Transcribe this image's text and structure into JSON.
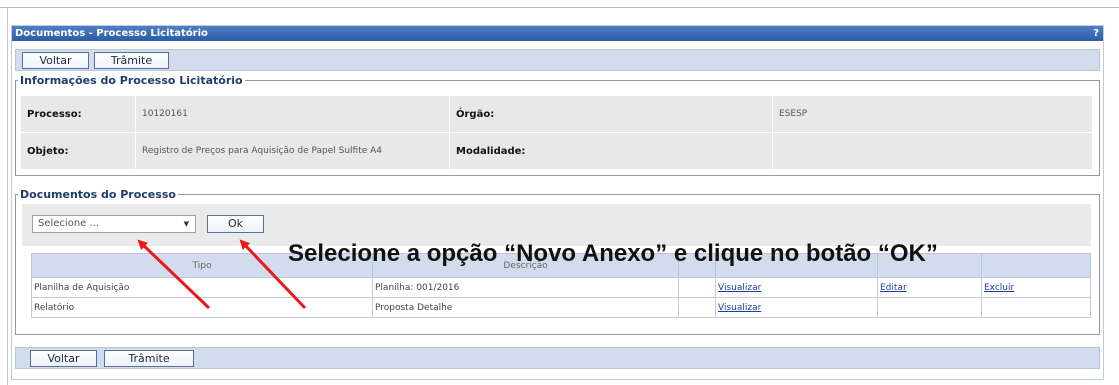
{
  "window": {
    "title": "Documentos - Processo Licitatório",
    "help_label": "?"
  },
  "toolbar_top": {
    "voltar_label": "Voltar",
    "tramite_label": "Trâmite"
  },
  "toolbar_bottom": {
    "voltar_label": "Voltar",
    "tramite_label": "Trâmite"
  },
  "info_section": {
    "legend": "Informações do Processo Licitatório",
    "processo_label": "Processo:",
    "processo_value": "10120161",
    "orgao_label": "Órgão:",
    "orgao_value": "ESESP",
    "objeto_label": "Objeto:",
    "objeto_value": "Registro de Preços para Aquisição de Papel Sulfite A4",
    "modalidade_label": "Modalidade:",
    "modalidade_value": ""
  },
  "docs_section": {
    "legend": "Documentos do Processo",
    "select_value": "Selecione ...",
    "ok_label": "Ok",
    "columns": [
      "Tipo",
      "Descrição",
      "",
      "",
      "",
      ""
    ],
    "rows": [
      {
        "tipo": "Planilha de Aquisição",
        "descricao": "Planilha: 001/2016",
        "visualizar": "Visualizar",
        "editar": "Editar",
        "excluir": "Excluir"
      },
      {
        "tipo": "Relatório",
        "descricao": "Proposta Detalhe",
        "visualizar": "Visualizar",
        "editar": "",
        "excluir": ""
      }
    ]
  },
  "annotation": {
    "text": "Selecione a opção “Novo Anexo” e clique no botão “OK”",
    "arrow_color": "#e8191d"
  }
}
